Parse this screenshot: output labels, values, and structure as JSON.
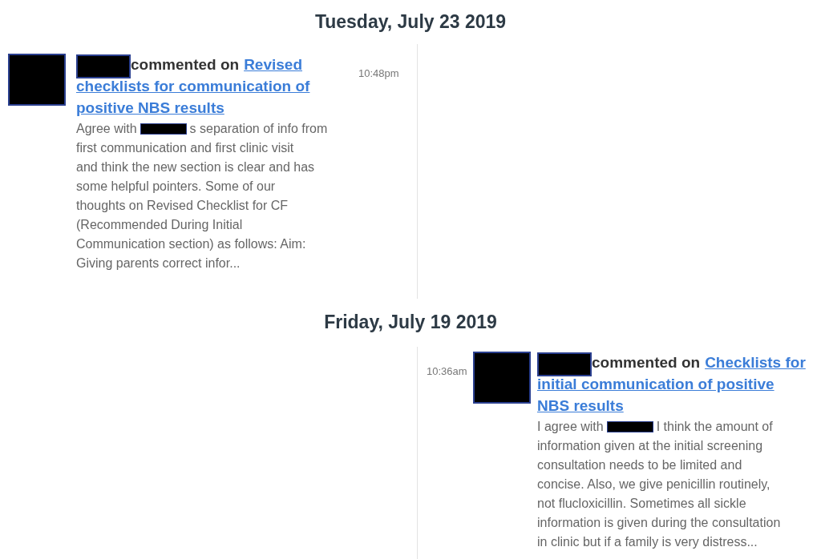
{
  "days": [
    {
      "date": "Tuesday, July 23 2019",
      "entries": [
        {
          "kind": "left",
          "action": "commented on",
          "link_lines": [
            "Revised",
            "checklists for communication of",
            "positive NBS results"
          ],
          "time": "10:48pm",
          "body_first": [
            "Agree with",
            "s separation of info from"
          ],
          "body_lines": [
            "first communication and first clinic visit",
            "and think the new section is clear and has",
            "some helpful pointers. Some of our",
            "thoughts on Revised Checklist for CF",
            "(Recommended During Initial",
            "Communication section) as follows: Aim:",
            "Giving parents correct infor..."
          ]
        }
      ]
    },
    {
      "date": "Friday, July 19 2019",
      "entries": [
        {
          "kind": "right",
          "action": "commented on",
          "link_lines": [
            "Checklists for",
            "initial communication of positive",
            "NBS results"
          ],
          "time": "10:36am",
          "body_first": [
            "I agree with",
            "I think the amount of"
          ],
          "body_lines": [
            "information given at the initial screening",
            "consultation needs to be limited and",
            "concise. Also, we give penicillin routinely,",
            "not flucloxicillin.  Sometimes all sickle",
            "information is given during the consultation",
            "in clinic but if a family is very distress..."
          ]
        }
      ]
    }
  ]
}
